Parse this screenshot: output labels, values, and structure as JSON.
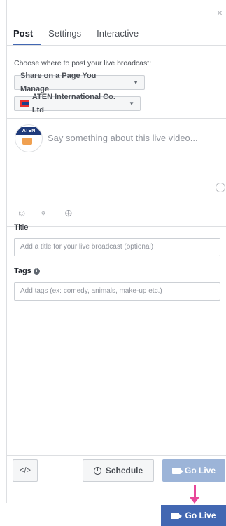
{
  "header": {
    "close_glyph": "×",
    "tabs": [
      {
        "label": "Post",
        "active": true
      },
      {
        "label": "Settings",
        "active": false
      },
      {
        "label": "Interactive",
        "active": false
      }
    ]
  },
  "post": {
    "destination_label": "Choose where to post your live broadcast:",
    "destination_value": "Share on a Page You Manage",
    "page_value": "ATEN International Co. Ltd",
    "avatar_text": "ATEN",
    "composer_placeholder": "Say something about this live video..."
  },
  "fields": {
    "title_label": "Title",
    "title_placeholder": "Add a title for your live broadcast (optional)",
    "tags_label": "Tags",
    "tags_placeholder": "Add tags (ex: comedy, animals, make-up etc.)"
  },
  "footer": {
    "embed_label": "</>",
    "schedule_label": "Schedule",
    "go_live_disabled_label": "Go Live",
    "go_live_label": "Go Live"
  },
  "colors": {
    "accent": "#4267b2",
    "accent_disabled": "#9cb4d8",
    "arrow": "#e8489a"
  }
}
